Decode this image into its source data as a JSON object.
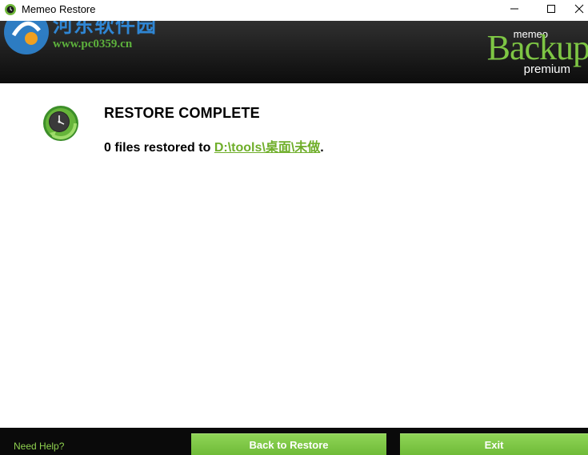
{
  "window": {
    "title": "Memeo Restore",
    "icon": "memeo-app-icon",
    "controls": {
      "minimize_icon": "minimize-icon",
      "maximize_icon": "maximize-icon",
      "close_icon": "close-icon"
    }
  },
  "header": {
    "watermark_cn": "河东软件园",
    "watermark_url": "www.pc0359.cn",
    "brand": {
      "memeo": "memeo",
      "backup": "Backup",
      "premium": "premium",
      "accent_color": "#7ec644"
    }
  },
  "content": {
    "status_icon": "clock-refresh-icon",
    "heading": "RESTORE COMPLETE",
    "message_prefix": "0 files restored to ",
    "restore_path": "D:\\tools\\桌面\\未做",
    "message_suffix": ".",
    "link_color": "#6fae2a"
  },
  "footer": {
    "help_label": "Need Help?",
    "back_button_label": "Back to Restore",
    "exit_button_label": "Exit",
    "button_color": "#7cc444"
  }
}
